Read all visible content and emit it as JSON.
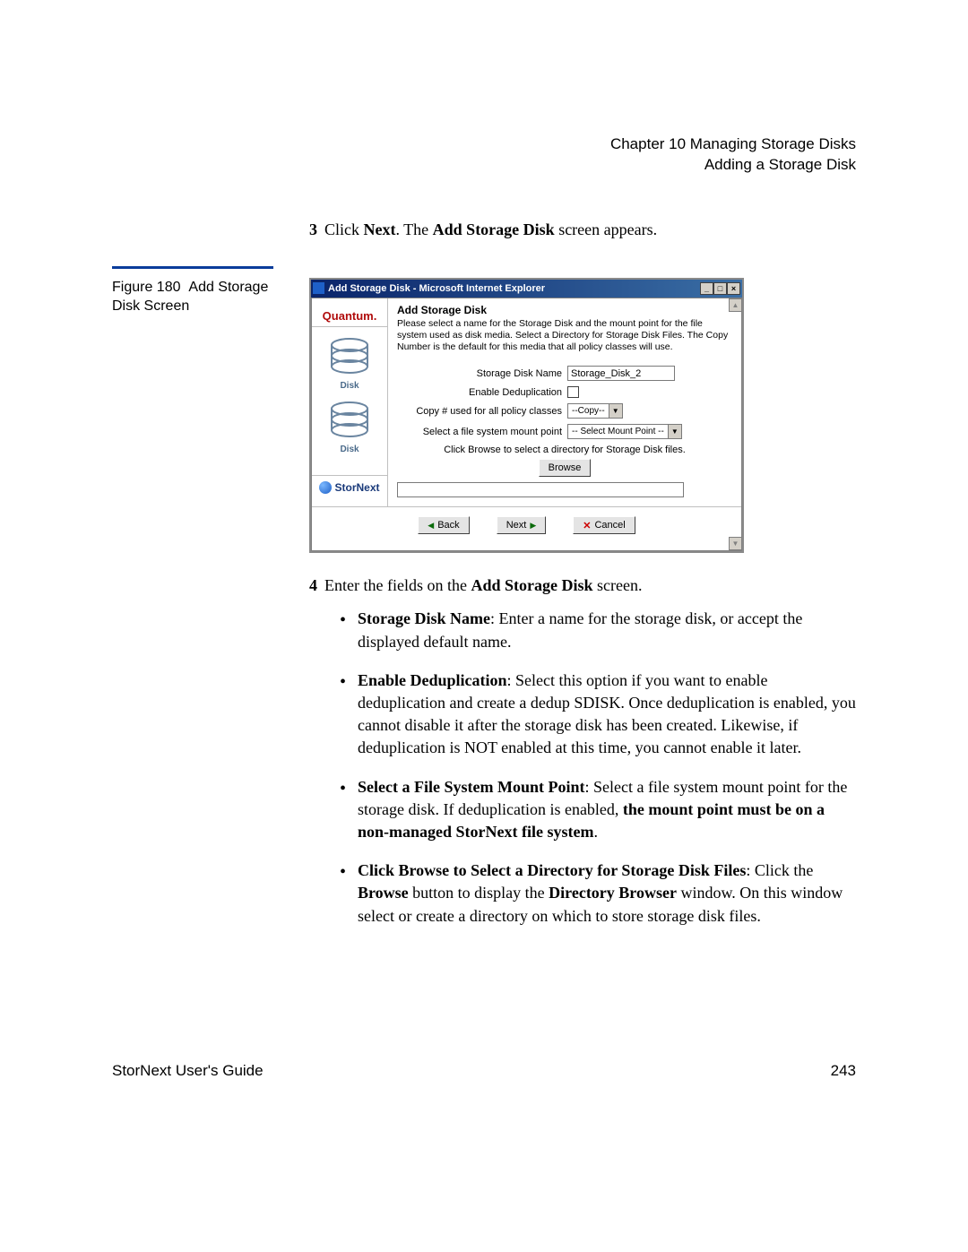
{
  "header": {
    "chapter": "Chapter 10  Managing Storage Disks",
    "section": "Adding a Storage Disk"
  },
  "step3": {
    "num": "3",
    "pre": "Click ",
    "next": "Next",
    "mid": ". The ",
    "screen": "Add Storage Disk",
    "post": " screen appears."
  },
  "figure": {
    "label": "Figure 180",
    "caption": "Add Storage Disk Screen"
  },
  "dialog": {
    "title": "Add Storage Disk - Microsoft Internet Explorer",
    "brand": "Quantum.",
    "panel_title": "Add Storage Disk",
    "panel_desc": "Please select a name for the Storage Disk and the mount point for the file system used as disk media. Select a Directory for Storage Disk Files. The Copy Number is the default for this media that all policy classes will use.",
    "disk_label": "Disk",
    "stornext": "StorNext",
    "form": {
      "name_label": "Storage Disk Name",
      "name_value": "Storage_Disk_2",
      "dedup_label": "Enable Deduplication",
      "copy_label": "Copy # used for all policy classes",
      "copy_value": " --Copy-- ",
      "mount_label": "Select a file system mount point",
      "mount_value": " -- Select Mount Point -- ",
      "browse_hint": "Click Browse to select a directory for Storage Disk files.",
      "browse_btn": "Browse"
    },
    "buttons": {
      "back": "Back",
      "next": "Next",
      "cancel": "Cancel"
    },
    "winbtns": {
      "min": "_",
      "max": "□",
      "close": "×"
    }
  },
  "step4": {
    "num": "4",
    "intro_pre": "Enter the fields on the ",
    "intro_bold": "Add Storage Disk",
    "intro_post": " screen.",
    "items": [
      {
        "lead": "Storage Disk Name",
        "rest": ": Enter a name for the storage disk, or accept the displayed default name."
      },
      {
        "lead": "Enable Deduplication",
        "rest": ": Select this option if you want to enable deduplication and create a dedup SDISK. Once deduplication is enabled, you cannot disable it after the storage disk has been created. Likewise, if deduplication is NOT enabled at this time, you cannot enable it later."
      },
      {
        "lead": "Select a File System Mount Point",
        "rest_pre": ": Select a file system mount point for the storage disk. If deduplication is enabled, ",
        "rest_bold": "the mount point must be on a non-managed StorNext file system",
        "rest_post": "."
      },
      {
        "lead": "Click Browse to Select a Directory for Storage Disk Files",
        "rest_pre": ": Click the ",
        "rest_b1": "Browse",
        "rest_mid": " button to display the ",
        "rest_b2": "Directory Browser",
        "rest_post": " window. On this window select or create a directory on which to store storage disk files."
      }
    ]
  },
  "footer": {
    "left": "StorNext User's Guide",
    "right": "243"
  },
  "chart_data": null
}
